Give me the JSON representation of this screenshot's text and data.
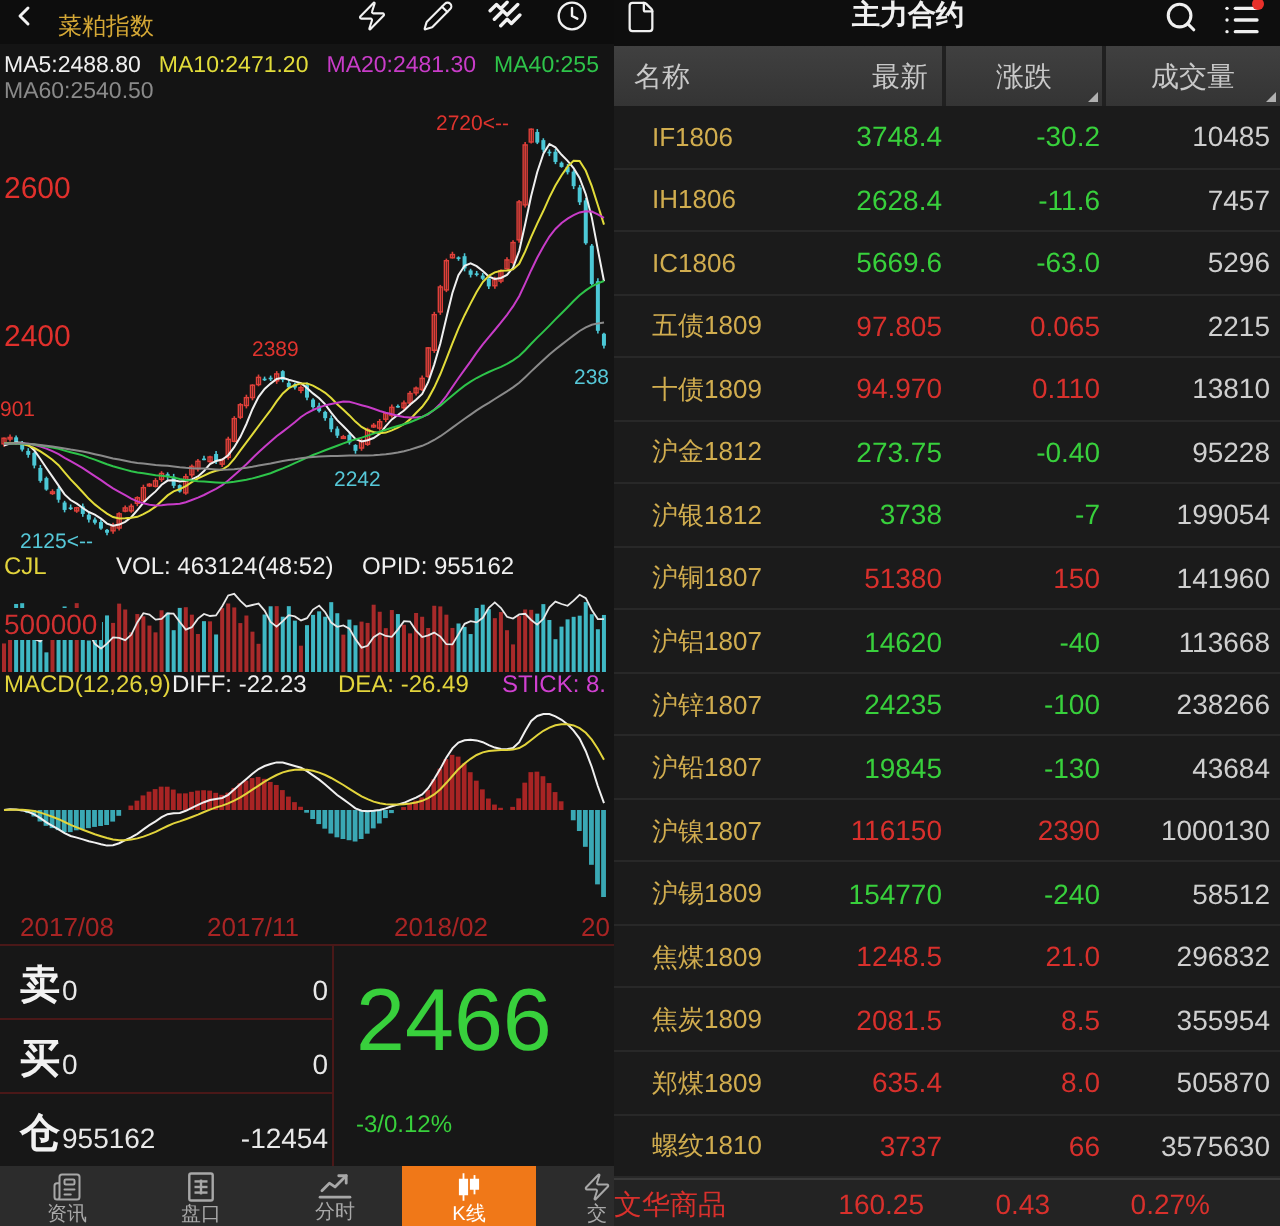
{
  "header": {
    "title": "菜粕指数"
  },
  "moving_averages": [
    {
      "label": "MA5:2488.80",
      "color": "#f0f0f0"
    },
    {
      "label": "MA10:2471.20",
      "color": "#e2dc3a"
    },
    {
      "label": "MA20:2481.30",
      "color": "#c83cc8"
    },
    {
      "label": "MA40:255",
      "color": "#2ec44a"
    },
    {
      "label": "MA60:2540.50",
      "color": "#8a8a8a"
    }
  ],
  "price_chart": {
    "axis_labels": [
      "2600",
      "2400"
    ],
    "annotations": [
      {
        "text": "2720<--",
        "kind": "high"
      },
      {
        "text": "2389",
        "kind": "high"
      },
      {
        "text": "238",
        "kind": "low"
      },
      {
        "text": "901",
        "kind": "high"
      },
      {
        "text": "2242",
        "kind": "low"
      },
      {
        "text": "2125<--",
        "kind": "low"
      }
    ]
  },
  "volume_panel": {
    "indicator": "CJL",
    "volume": "VOL: 463124(48:52)",
    "open_interest": "OPID: 955162",
    "axis_label": "500000"
  },
  "macd_panel": {
    "title": "MACD(12,26,9)",
    "diff": "DIFF: -22.23",
    "dea": "DEA: -26.49",
    "stick": "STICK: 8."
  },
  "date_axis": [
    "2017/08",
    "2017/11",
    "2018/02",
    "20"
  ],
  "quote": {
    "rows": [
      {
        "label": "卖",
        "value": "0",
        "amount": "0"
      },
      {
        "label": "买",
        "value": "0",
        "amount": "0"
      },
      {
        "label": "仓",
        "value": "955162",
        "amount": "-12454"
      }
    ],
    "last_price": "2466",
    "change": "-3/0.12%",
    "color": "#38d03c"
  },
  "bottom_tabs": [
    {
      "label": "资讯",
      "selected": false
    },
    {
      "label": "盘口",
      "selected": false
    },
    {
      "label": "分时",
      "selected": false
    },
    {
      "label": "K线",
      "selected": true
    },
    {
      "label": "交",
      "selected": false
    }
  ],
  "market_list": {
    "title": "主力合约",
    "columns": [
      {
        "label": "名称",
        "sortable": false
      },
      {
        "label": "最新",
        "sortable": false
      },
      {
        "label": "涨跌",
        "sortable": true
      },
      {
        "label": "成交量",
        "sortable": true
      }
    ],
    "rows": [
      {
        "name": "IF1806",
        "price": "3748.4",
        "change": "-30.2",
        "volume": "10485",
        "color": "#38d03c"
      },
      {
        "name": "IH1806",
        "price": "2628.4",
        "change": "-11.6",
        "volume": "7457",
        "color": "#38d03c"
      },
      {
        "name": "IC1806",
        "price": "5669.6",
        "change": "-63.0",
        "volume": "5296",
        "color": "#38d03c"
      },
      {
        "name": "五债1809",
        "price": "97.805",
        "change": "0.065",
        "volume": "2215",
        "color": "#d8302c"
      },
      {
        "name": "十债1809",
        "price": "94.970",
        "change": "0.110",
        "volume": "13810",
        "color": "#d8302c"
      },
      {
        "name": "沪金1812",
        "price": "273.75",
        "change": "-0.40",
        "volume": "95228",
        "color": "#38d03c"
      },
      {
        "name": "沪银1812",
        "price": "3738",
        "change": "-7",
        "volume": "199054",
        "color": "#38d03c"
      },
      {
        "name": "沪铜1807",
        "price": "51380",
        "change": "150",
        "volume": "141960",
        "color": "#d8302c"
      },
      {
        "name": "沪铝1807",
        "price": "14620",
        "change": "-40",
        "volume": "113668",
        "color": "#38d03c"
      },
      {
        "name": "沪锌1807",
        "price": "24235",
        "change": "-100",
        "volume": "238266",
        "color": "#38d03c"
      },
      {
        "name": "沪铅1807",
        "price": "19845",
        "change": "-130",
        "volume": "43684",
        "color": "#38d03c"
      },
      {
        "name": "沪镍1807",
        "price": "116150",
        "change": "2390",
        "volume": "1000130",
        "color": "#d8302c"
      },
      {
        "name": "沪锡1809",
        "price": "154770",
        "change": "-240",
        "volume": "58512",
        "color": "#38d03c"
      },
      {
        "name": "焦煤1809",
        "price": "1248.5",
        "change": "21.0",
        "volume": "296832",
        "color": "#d8302c"
      },
      {
        "name": "焦炭1809",
        "price": "2081.5",
        "change": "8.5",
        "volume": "355954",
        "color": "#d8302c"
      },
      {
        "name": "郑煤1809",
        "price": "635.4",
        "change": "8.0",
        "volume": "505870",
        "color": "#d8302c"
      },
      {
        "name": "螺纹1810",
        "price": "3737",
        "change": "66",
        "volume": "3575630",
        "color": "#d8302c"
      }
    ],
    "summary": {
      "name": "文华商品",
      "price": "160.25",
      "change": "0.43",
      "percent": "0.27%",
      "color": "#d8302c"
    }
  }
}
